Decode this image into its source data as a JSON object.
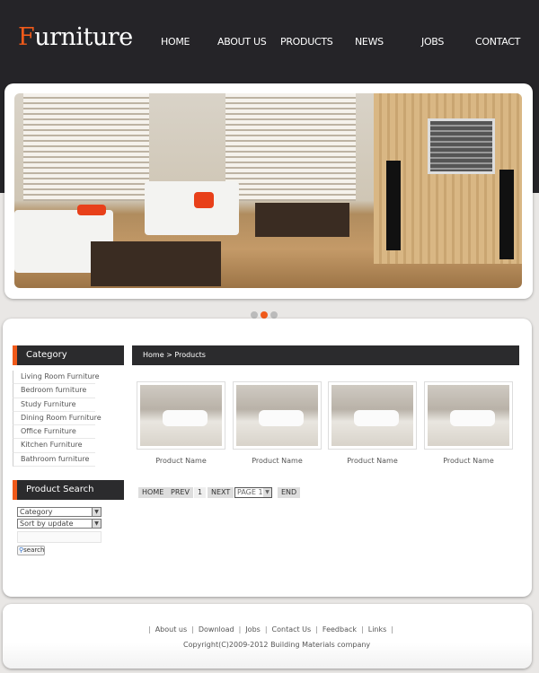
{
  "header": {
    "logo_first": "F",
    "logo_rest": "urniture",
    "nav": [
      "HOME",
      "ABOUT US",
      "PRODUCTS",
      "NEWS",
      "JOBS",
      "CONTACT"
    ]
  },
  "slider": {
    "slides": 3,
    "active": 2
  },
  "sidebar": {
    "category_title": "Category",
    "categories": [
      "Living Room Furniture",
      "Bedroom furniture",
      "Study Furniture",
      "Dining Room Furniture",
      "Office Furniture",
      "Kitchen Furniture",
      "Bathroom furniture"
    ],
    "search_title": "Product Search",
    "category_select": "Category",
    "sort_select": "Sort by update",
    "keyword_value": "",
    "search_button": "search"
  },
  "main": {
    "breadcrumb": "Home > Products",
    "products": [
      "Product Name",
      "Product Name",
      "Product Name",
      "Product Name"
    ],
    "pagination": {
      "home": "HOME",
      "prev": "PREV",
      "page": "1",
      "next": "NEXT",
      "page_select": "PAGE 1",
      "end": "END"
    }
  },
  "footer": {
    "links": [
      "About us",
      "Download",
      "Jobs",
      "Contact Us",
      "Feedback",
      "Links"
    ],
    "copyright": "Copyright(C)2009-2012 Building Materials company"
  },
  "colors": {
    "accent": "#f05a1a",
    "header_bg": "#252428"
  }
}
